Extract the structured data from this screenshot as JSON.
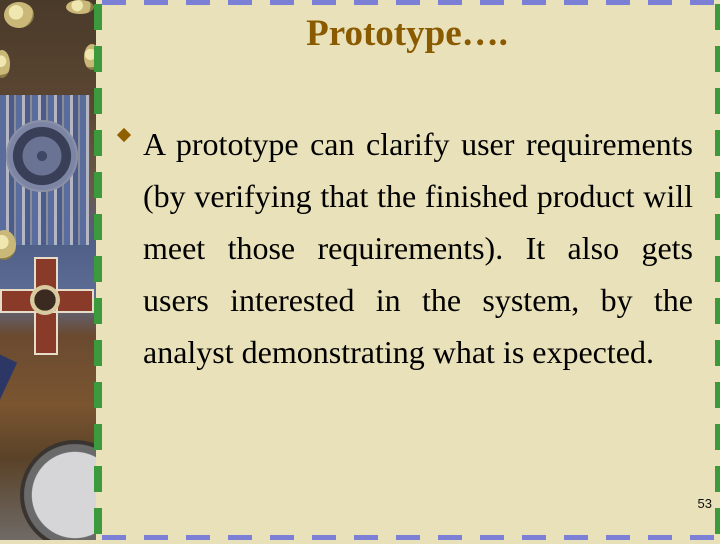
{
  "slide": {
    "title": "Prototype….",
    "bullets": [
      {
        "icon": "diamond-bullet-icon",
        "text": "A prototype can clarify user requirements (by verifying that the finished product will meet those requirements).  It also gets users interested in the system, by the analyst demonstrating what is expected."
      }
    ],
    "page_number": "53"
  },
  "colors": {
    "background": "#e9e1b9",
    "title": "#8a5a00",
    "bullet": "#8f5f00",
    "border_green": "#3c9a3c",
    "border_blue": "#7b80d6"
  }
}
